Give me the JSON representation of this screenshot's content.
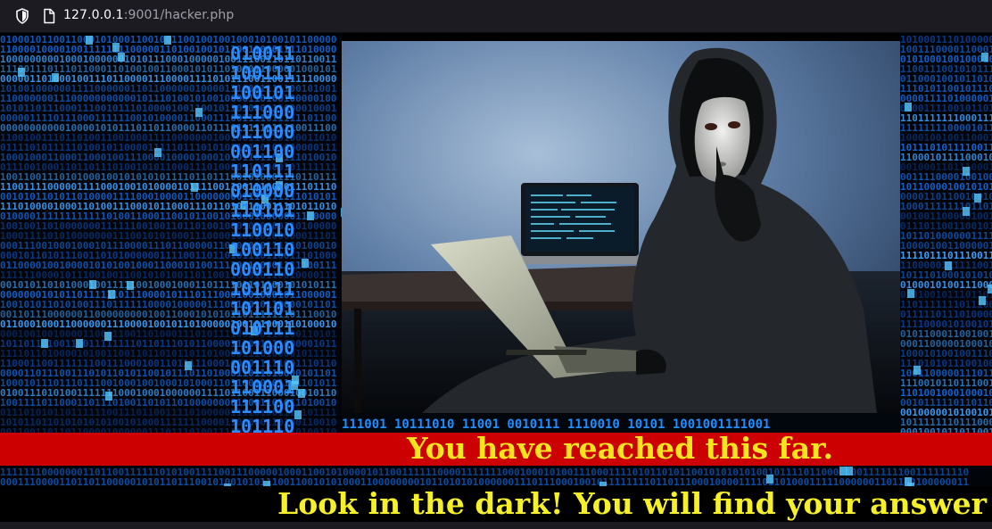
{
  "browser": {
    "url_host": "127.0.0.1",
    "url_rest": ":9001/hacker.php",
    "shield_icon": "shield-icon",
    "page_icon": "page-icon"
  },
  "page": {
    "banner_red_text": "You have reached this far.",
    "banner_black_text": "Look in the dark! You will find your answer",
    "binary_row_text": "111001 10111010 11001 0010111 1110010 10101 1001001111001"
  },
  "colors": {
    "red_bar": "#cc0000",
    "text_yellow": "#f6e51e",
    "binary_blue": "#1f8fff"
  }
}
